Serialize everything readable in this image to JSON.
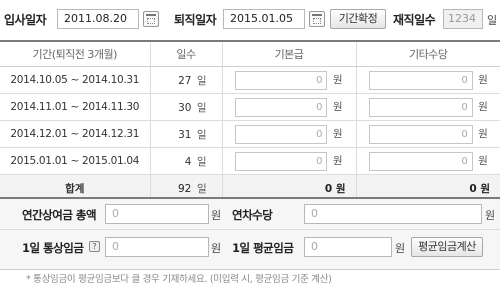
{
  "top": {
    "hire_label": "입사일자",
    "hire_value": "2011.08.20",
    "leave_label": "퇴직일자",
    "leave_value": "2015.01.05",
    "confirm_button": "기간확정",
    "tenure_label": "재직일수",
    "tenure_value": "1234",
    "tenure_unit": "일"
  },
  "table": {
    "headers": [
      "기간(퇴직전 3개월)",
      "일수",
      "기본급",
      "기타수당"
    ],
    "rows": [
      {
        "period": "2014.10.05 ~ 2014.10.31",
        "days": "27",
        "day_unit": "일",
        "base": "0",
        "base_unit": "원",
        "other": "0",
        "other_unit": "원"
      },
      {
        "period": "2014.11.01 ~ 2014.11.30",
        "days": "30",
        "day_unit": "일",
        "base": "0",
        "base_unit": "원",
        "other": "0",
        "other_unit": "원"
      },
      {
        "period": "2014.12.01 ~ 2014.12.31",
        "days": "31",
        "day_unit": "일",
        "base": "0",
        "base_unit": "원",
        "other": "0",
        "other_unit": "원"
      },
      {
        "period": "2015.01.01 ~ 2015.01.04",
        "days": "4",
        "day_unit": "일",
        "base": "0",
        "base_unit": "원",
        "other": "0",
        "other_unit": "원"
      }
    ],
    "total": {
      "label": "합계",
      "days": "92",
      "day_unit": "일",
      "base": "0 원",
      "other": "0 원"
    }
  },
  "bonus": {
    "annual_bonus_label": "연간상여금 총액",
    "annual_bonus_value": "0",
    "annual_bonus_unit": "원",
    "annual_leave_label": "연차수당",
    "annual_leave_value": "0",
    "annual_leave_unit": "원"
  },
  "wage": {
    "ordinary_label": "1일 통상임금",
    "ordinary_help": "?",
    "ordinary_value": "0",
    "ordinary_unit": "원",
    "average_label": "1일 평균임금",
    "average_value": "0",
    "average_unit": "원",
    "calc_button": "평균임금계산"
  },
  "note": "* 통상임금이 평균임금보다 클 경우 기재하세요. (미입력 시, 평균임금 기준 계산)"
}
